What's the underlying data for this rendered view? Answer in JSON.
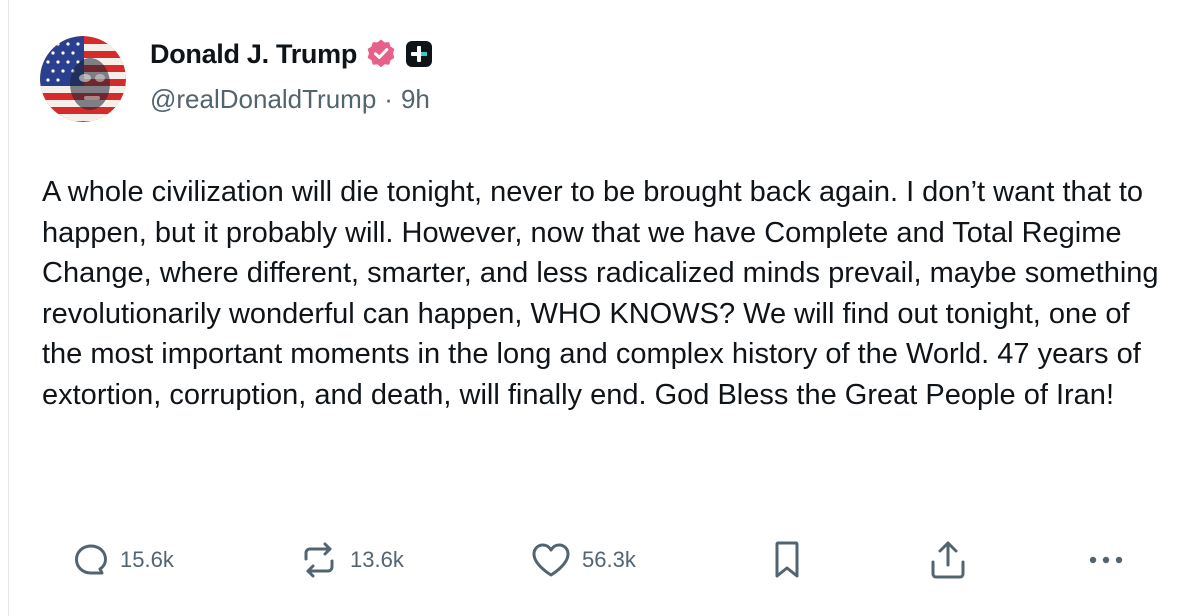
{
  "author": {
    "display_name": "Donald J. Trump",
    "handle": "@realDonaldTrump",
    "separator": "·",
    "time_ago": "9h",
    "verified_badge_color": "#e8608a",
    "plus_badge_color": "#0f1419"
  },
  "post": {
    "text": "A whole civilization will die tonight, never to be brought back again. I don’t want that to happen, but it probably will. However, now that we have Complete and Total Regime Change, where different, smarter, and less radicalized minds prevail, maybe something revolutionarily wonderful can happen, WHO KNOWS? We will find out tonight, one of the most important moments in the long and complex history of the World. 47 years of extortion, corruption, and death, will finally end. God Bless the Great People of Iran!"
  },
  "actions": {
    "replies": "15.6k",
    "reposts": "13.6k",
    "likes": "56.3k",
    "icons": [
      "reply-icon",
      "repost-icon",
      "like-icon",
      "bookmark-icon",
      "share-icon",
      "more-icon"
    ]
  },
  "colors": {
    "text": "#0f1419",
    "muted": "#536471"
  }
}
